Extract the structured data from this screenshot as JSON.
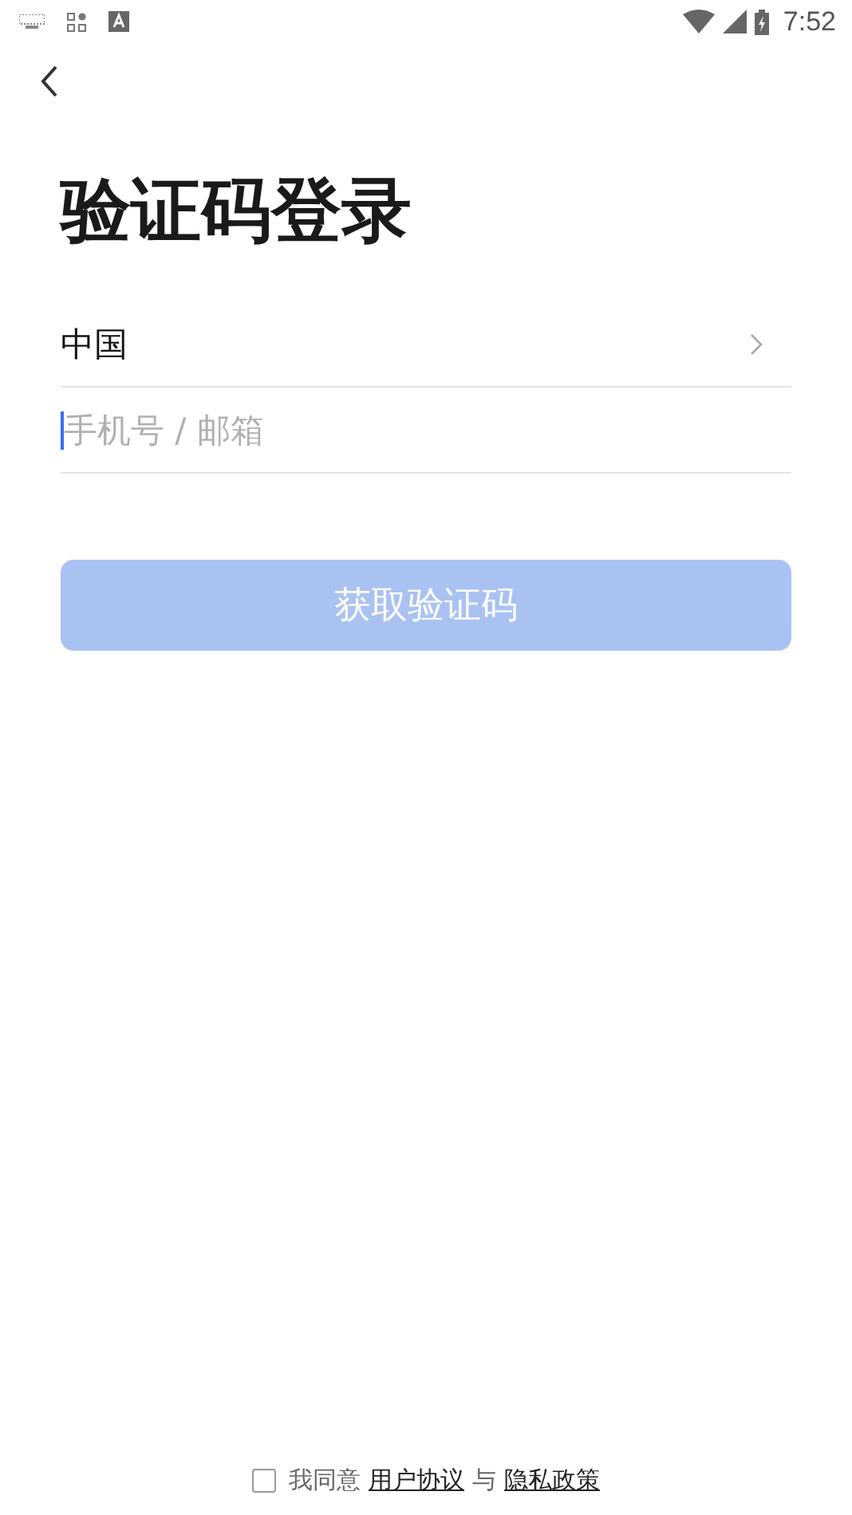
{
  "status_bar": {
    "time": "7:52"
  },
  "title": "验证码登录",
  "region": {
    "value": "中国"
  },
  "account_field": {
    "placeholder": "手机号 / 邮箱",
    "focused": true
  },
  "submit_button": {
    "label": "获取验证码",
    "disabled": true
  },
  "agreement": {
    "checked": false,
    "prefix": "我同意",
    "link_1": "用户协议",
    "joiner": "与",
    "link_2": "隐私政策"
  }
}
